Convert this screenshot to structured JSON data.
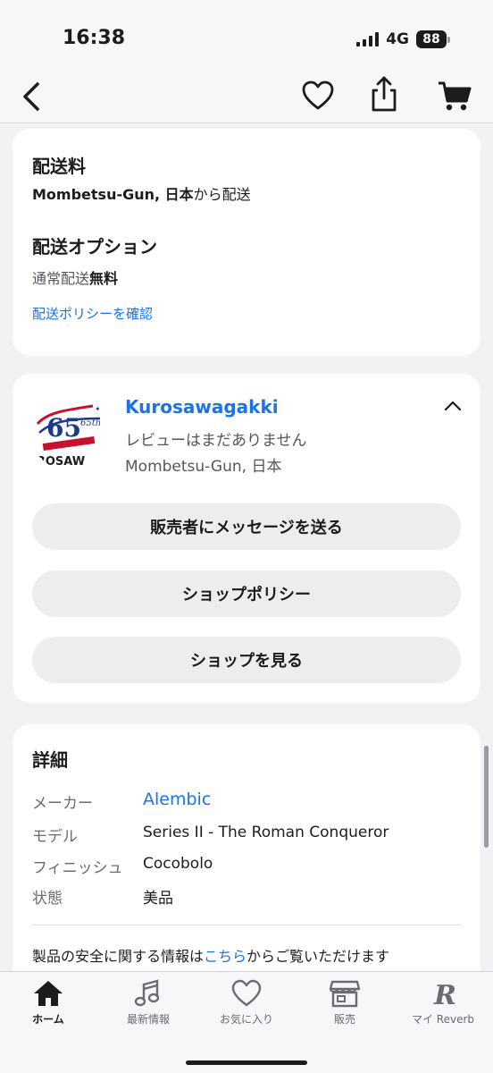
{
  "status": {
    "time": "16:38",
    "network": "4G",
    "battery": "88"
  },
  "nav": {
    "back_icon": "chevron-left-icon",
    "favorite_icon": "heart-icon",
    "share_icon": "share-icon",
    "cart_icon": "cart-icon"
  },
  "shipping": {
    "title": "配送料",
    "from_bold": "Mombetsu-Gun, 日本",
    "from_suffix": "から配送",
    "options_title": "配送オプション",
    "standard_label": "通常配送",
    "standard_price": "無料",
    "policy_link": "配送ポリシーを確認"
  },
  "seller": {
    "logo_text": "IROSAW",
    "logo_badge": "65th",
    "name": "Kurosawagakki",
    "reviews": "レビューはまだありません",
    "location": "Mombetsu-Gun, 日本",
    "message_button": "販売者にメッセージを送る",
    "policy_button": "ショップポリシー",
    "shop_button": "ショップを見る"
  },
  "details": {
    "title": "詳細",
    "rows": [
      {
        "label": "メーカー",
        "value": "Alembic",
        "link": true
      },
      {
        "label": "モデル",
        "value": "Series II - The Roman Conqueror",
        "link": false
      },
      {
        "label": "フィニッシュ",
        "value": "Cocobolo",
        "link": false
      },
      {
        "label": "状態",
        "value": "美品",
        "link": false
      }
    ],
    "safety_prefix": "製品の安全に関する情報は",
    "safety_link": "こちら",
    "safety_suffix": "からご覧いただけます"
  },
  "tabs": [
    {
      "label": "ホーム",
      "icon": "home-icon",
      "active": true
    },
    {
      "label": "最新情報",
      "icon": "music-note-icon",
      "active": false
    },
    {
      "label": "お気に入り",
      "icon": "heart-icon",
      "active": false
    },
    {
      "label": "販売",
      "icon": "shop-icon",
      "active": false
    },
    {
      "label": "マイ Reverb",
      "icon": "reverb-r-icon",
      "active": false
    }
  ],
  "colors": {
    "link": "#1a73e8",
    "background": "#f2f2f4",
    "card": "#ffffff",
    "pill": "#ededf0"
  }
}
